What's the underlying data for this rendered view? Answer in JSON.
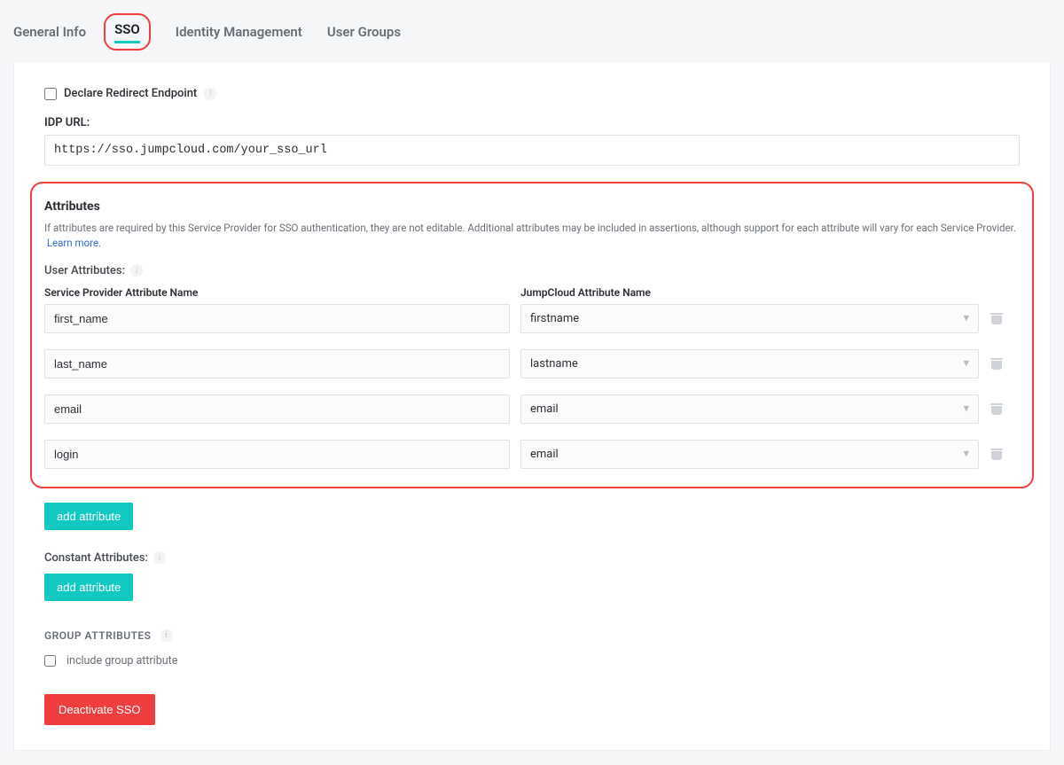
{
  "tabs": {
    "general_info": "General Info",
    "sso": "SSO",
    "identity_mgmt": "Identity Management",
    "user_groups": "User Groups"
  },
  "declare_redirect": {
    "label": "Declare Redirect Endpoint"
  },
  "idp_url": {
    "label": "IDP URL:",
    "value": "https://sso.jumpcloud.com/your_sso_url"
  },
  "attributes": {
    "title": "Attributes",
    "help": "If attributes are required by this Service Provider for SSO authentication, they are not editable. Additional attributes may be included in assertions, although support for each attribute will vary for each Service Provider.",
    "learn_more": "Learn more.",
    "user_attributes_label": "User Attributes:",
    "col_sp": "Service Provider Attribute Name",
    "col_jc": "JumpCloud Attribute Name",
    "rows": [
      {
        "sp": "first_name",
        "jc": "firstname"
      },
      {
        "sp": "last_name",
        "jc": "lastname"
      },
      {
        "sp": "email",
        "jc": "email"
      },
      {
        "sp": "login",
        "jc": "email"
      }
    ]
  },
  "add_attribute_label": "add attribute",
  "constant_attributes_label": "Constant Attributes:",
  "group_attributes_label": "GROUP ATTRIBUTES",
  "include_group_label": "include group attribute",
  "deactivate_label": "Deactivate SSO"
}
